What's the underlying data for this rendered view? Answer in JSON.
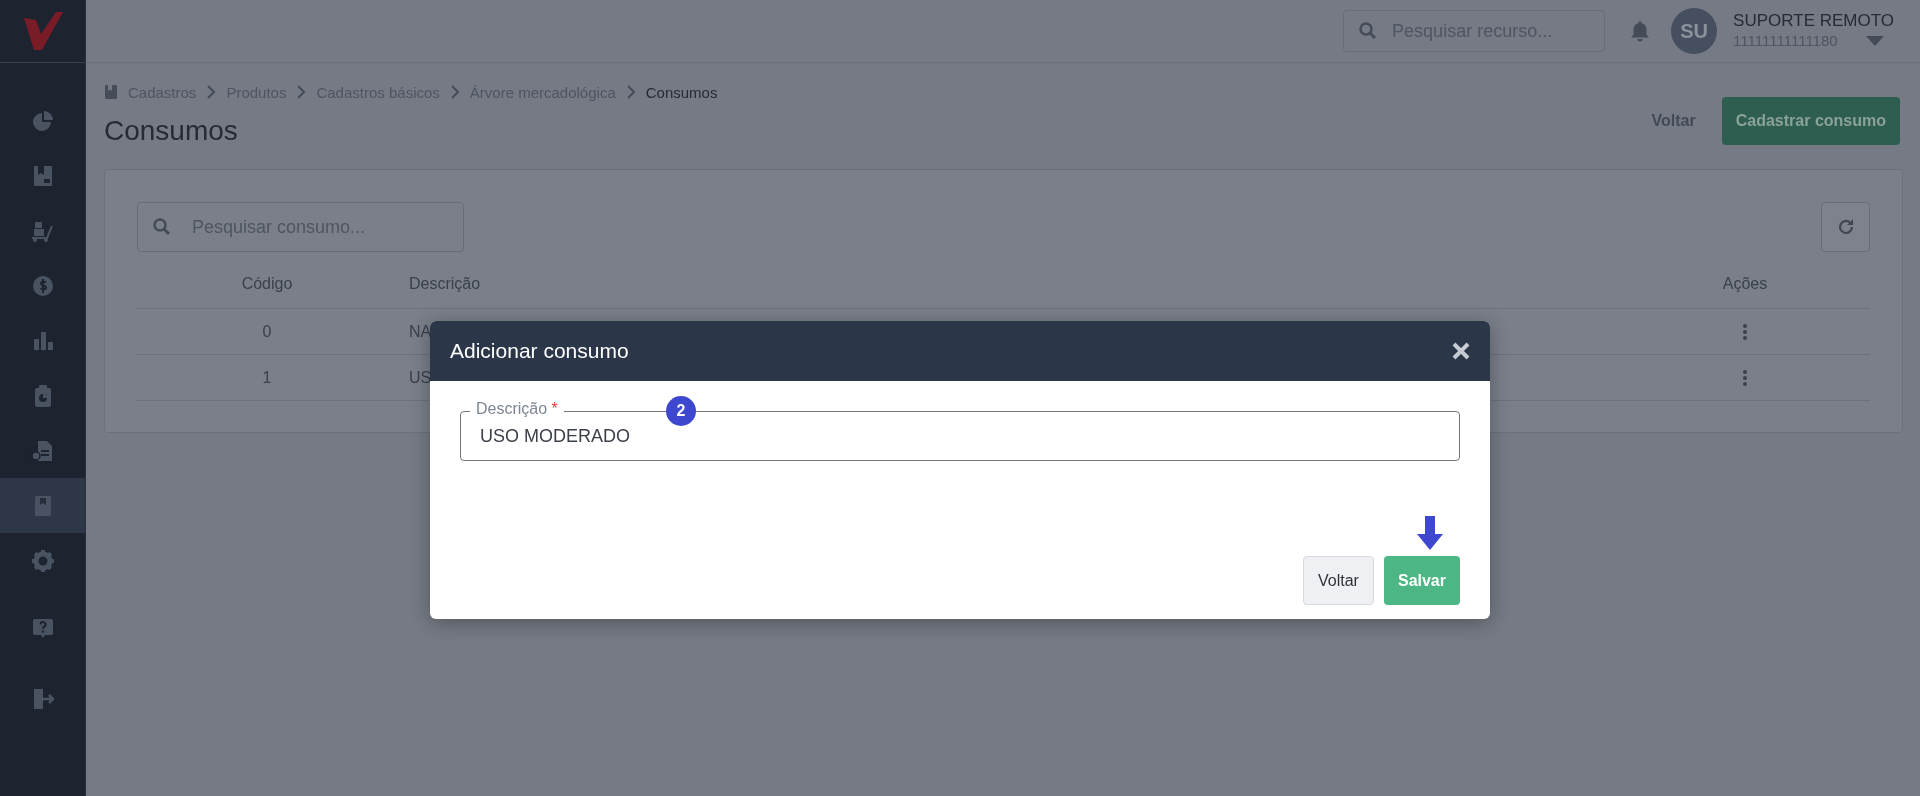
{
  "sidebar": {
    "items": [
      {
        "kind": "pie",
        "selected": false
      },
      {
        "kind": "bookmark",
        "selected": false
      },
      {
        "kind": "cart",
        "selected": false
      },
      {
        "kind": "dollar",
        "selected": false
      },
      {
        "kind": "bars",
        "selected": false
      },
      {
        "kind": "clipboard",
        "selected": false
      },
      {
        "kind": "certificate",
        "selected": false
      },
      {
        "kind": "book",
        "selected": true
      },
      {
        "kind": "gear",
        "selected": false
      }
    ],
    "bottom_items": [
      {
        "kind": "help",
        "selected": false
      },
      {
        "kind": "logout",
        "selected": false
      }
    ]
  },
  "topbar": {
    "search": {
      "placeholder": "Pesquisar recurso..."
    },
    "user": {
      "initials": "SU",
      "name": "SUPORTE REMOTO",
      "id": "11111111111180"
    }
  },
  "breadcrumb": [
    {
      "label": "Cadastros",
      "current": false
    },
    {
      "label": "Produtos",
      "current": false
    },
    {
      "label": "Cadastros básicos",
      "current": false
    },
    {
      "label": "Árvore mercadológica",
      "current": false
    },
    {
      "label": "Consumos",
      "current": true
    }
  ],
  "page": {
    "title": "Consumos",
    "actions": [
      {
        "label": "Voltar",
        "kind": "link"
      },
      {
        "label": "Cadastrar consumo",
        "kind": "primary"
      }
    ]
  },
  "list": {
    "search": {
      "placeholder": "Pesquisar consumo..."
    },
    "columns": [
      "Código",
      "Descrição",
      "Ações"
    ],
    "rows": [
      {
        "code": "0",
        "description": "NA"
      },
      {
        "code": "1",
        "description": "US"
      }
    ]
  },
  "dialog": {
    "title": "Adicionar consumo",
    "field": {
      "label": "Descrição",
      "required_mark": "*",
      "value": "USO MODERADO"
    },
    "step_badge": "2",
    "buttons": [
      {
        "label": "Voltar",
        "kind": "secondary"
      },
      {
        "label": "Salvar",
        "kind": "primary"
      }
    ]
  }
}
